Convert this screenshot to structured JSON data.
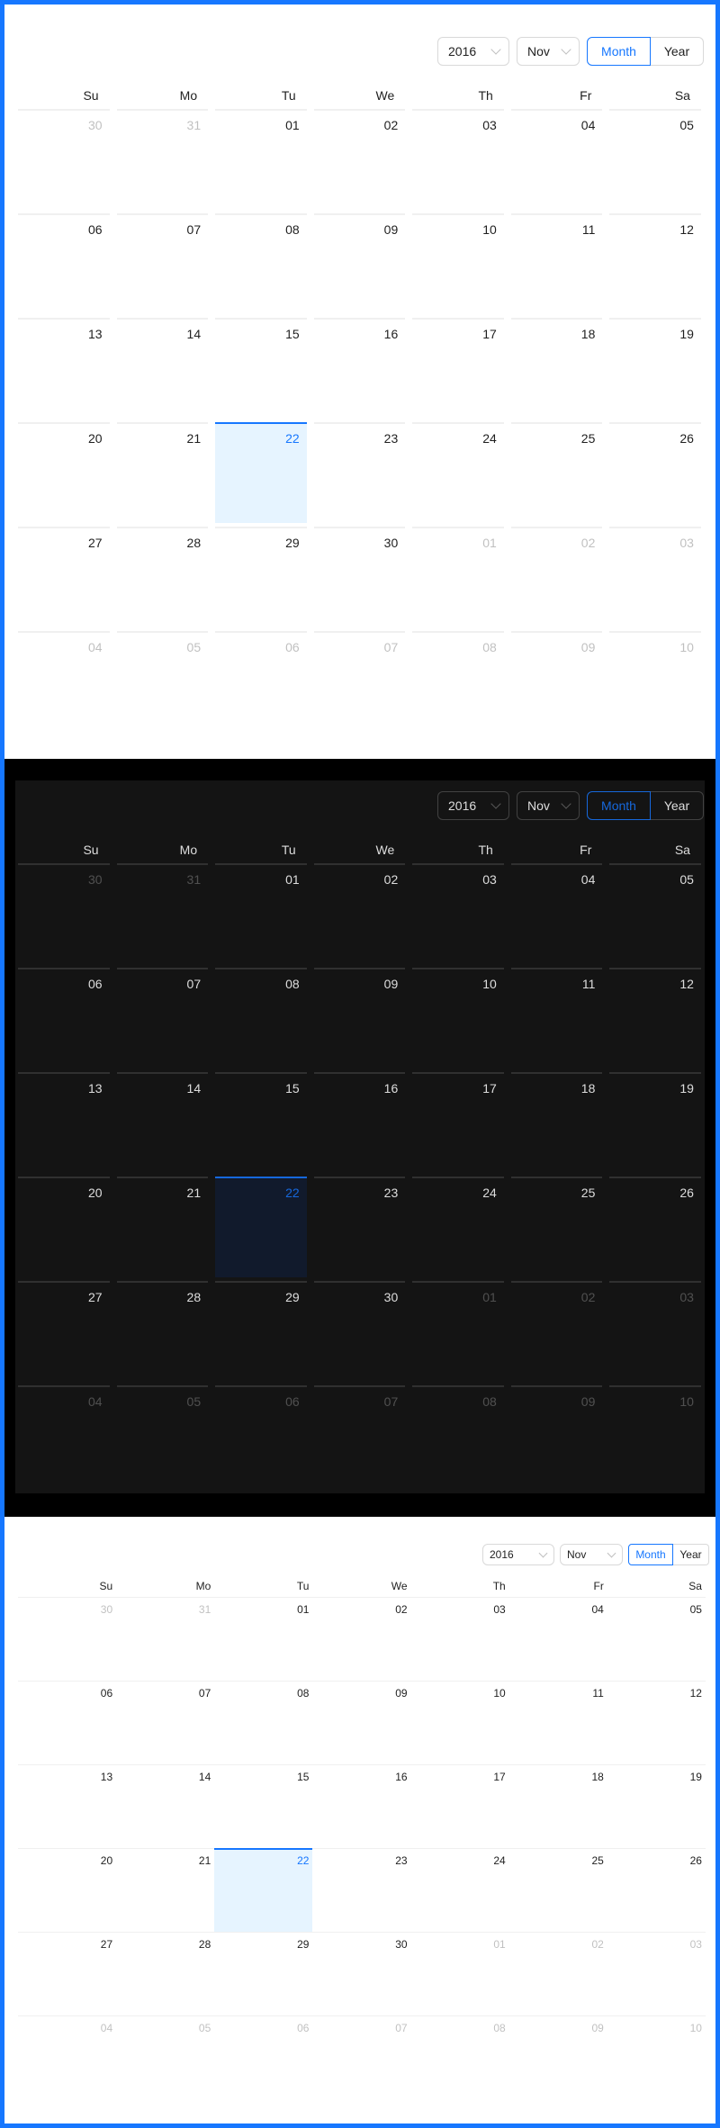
{
  "calendar": {
    "year": "2016",
    "month": "Nov",
    "mode_month": "Month",
    "mode_year": "Year",
    "weekdays": [
      "Su",
      "Mo",
      "Tu",
      "We",
      "Th",
      "Fr",
      "Sa"
    ],
    "weeks": [
      [
        {
          "d": "30",
          "out": true
        },
        {
          "d": "31",
          "out": true
        },
        {
          "d": "01",
          "out": false
        },
        {
          "d": "02",
          "out": false
        },
        {
          "d": "03",
          "out": false
        },
        {
          "d": "04",
          "out": false
        },
        {
          "d": "05",
          "out": false
        }
      ],
      [
        {
          "d": "06",
          "out": false
        },
        {
          "d": "07",
          "out": false
        },
        {
          "d": "08",
          "out": false
        },
        {
          "d": "09",
          "out": false
        },
        {
          "d": "10",
          "out": false
        },
        {
          "d": "11",
          "out": false
        },
        {
          "d": "12",
          "out": false
        }
      ],
      [
        {
          "d": "13",
          "out": false
        },
        {
          "d": "14",
          "out": false
        },
        {
          "d": "15",
          "out": false
        },
        {
          "d": "16",
          "out": false
        },
        {
          "d": "17",
          "out": false
        },
        {
          "d": "18",
          "out": false
        },
        {
          "d": "19",
          "out": false
        }
      ],
      [
        {
          "d": "20",
          "out": false
        },
        {
          "d": "21",
          "out": false
        },
        {
          "d": "22",
          "out": false,
          "today": true
        },
        {
          "d": "23",
          "out": false
        },
        {
          "d": "24",
          "out": false
        },
        {
          "d": "25",
          "out": false
        },
        {
          "d": "26",
          "out": false
        }
      ],
      [
        {
          "d": "27",
          "out": false
        },
        {
          "d": "28",
          "out": false
        },
        {
          "d": "29",
          "out": false
        },
        {
          "d": "30",
          "out": false
        },
        {
          "d": "01",
          "out": true
        },
        {
          "d": "02",
          "out": true
        },
        {
          "d": "03",
          "out": true
        }
      ],
      [
        {
          "d": "04",
          "out": true
        },
        {
          "d": "05",
          "out": true
        },
        {
          "d": "06",
          "out": true
        },
        {
          "d": "07",
          "out": true
        },
        {
          "d": "08",
          "out": true
        },
        {
          "d": "09",
          "out": true
        },
        {
          "d": "10",
          "out": true
        }
      ]
    ]
  },
  "colors": {
    "accent": "#1677ff",
    "today_bg_light": "#e6f4ff",
    "today_bg_dark": "#111a2c",
    "dark_bg": "#141414"
  }
}
